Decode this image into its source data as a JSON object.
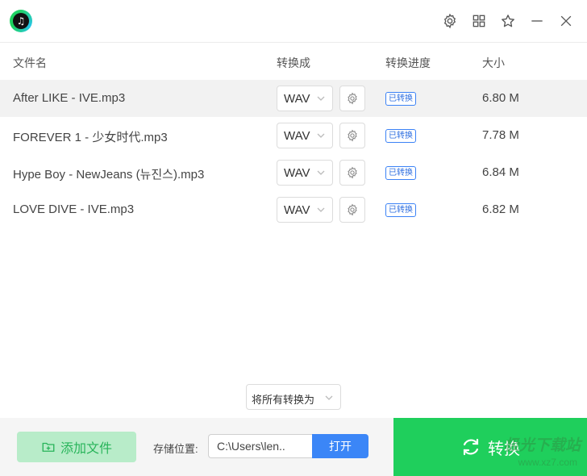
{
  "titlebar": {
    "logo_icon": "music-note-icon",
    "icons": [
      "gear-icon",
      "grid-icon",
      "star-icon",
      "minimize-icon",
      "close-icon"
    ]
  },
  "table": {
    "headers": {
      "filename": "文件名",
      "convert_to": "转换成",
      "progress": "转换进度",
      "size": "大小"
    },
    "rows": [
      {
        "filename": "After LIKE - IVE.mp3",
        "format": "WAV",
        "status": "已转换",
        "size": "6.80 M"
      },
      {
        "filename": "FOREVER 1 - 少女时代.mp3",
        "format": "WAV",
        "status": "已转换",
        "size": "7.78 M"
      },
      {
        "filename": "Hype Boy - NewJeans (뉴진스).mp3",
        "format": "WAV",
        "status": "已转换",
        "size": "6.84 M"
      },
      {
        "filename": "LOVE DIVE - IVE.mp3",
        "format": "WAV",
        "status": "已转换",
        "size": "6.82 M"
      }
    ]
  },
  "convert_all": {
    "label": "将所有转换为"
  },
  "bottom": {
    "add_file_label": "添加文件",
    "save_location_label": "存储位置:",
    "path_value": "C:\\Users\\len..",
    "open_label": "打开",
    "convert_label": "转换",
    "watermark": "极光下载站",
    "watermark_url": "www.xz7.com"
  },
  "colors": {
    "accent_green": "#1fcf5c",
    "add_button_bg": "#b8ecc9",
    "open_button_bg": "#3b86f7",
    "badge_blue": "#2f6fe0",
    "row_highlight": "#f2f2f2"
  }
}
